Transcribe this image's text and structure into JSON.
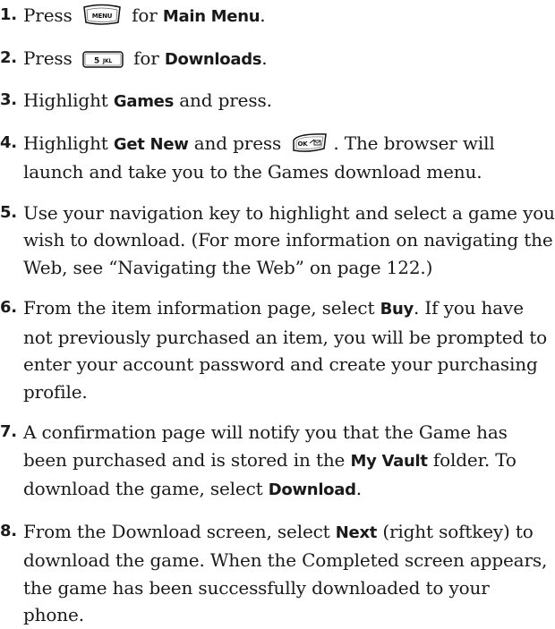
{
  "steps": [
    {
      "number": "1.",
      "parts": {
        "t1": "Press",
        "key": "MENU",
        "t2": "for",
        "b1": "Main Menu",
        "t3": "."
      }
    },
    {
      "number": "2.",
      "parts": {
        "t1": "Press",
        "key_num": "5",
        "key_letters": "JKL",
        "t2": "for",
        "b1": "Downloads",
        "t3": "."
      }
    },
    {
      "number": "3.",
      "parts": {
        "t1": "Highlight",
        "b1": "Games",
        "t2": "and press."
      }
    },
    {
      "number": "4.",
      "parts": {
        "t1": "Highlight",
        "b1": "Get New",
        "t2": "and press",
        "key": "OK",
        "t3": ". The browser will launch and take you to the Games download menu."
      }
    },
    {
      "number": "5.",
      "parts": {
        "t1": "Use your navigation key to highlight and select a game you wish to download. (For more information on navigating the Web, see “Navigating the Web” on page 122.)"
      }
    },
    {
      "number": "6.",
      "parts": {
        "t1": "From the item information page, select",
        "b1": "Buy",
        "t2": ". If you have not previously purchased an item, you will be prompted to enter your account password and create your purchasing profile."
      }
    },
    {
      "number": "7.",
      "parts": {
        "t1": "A confirmation page will notify you that the Game has been purchased and is stored in the",
        "b1": "My Vault",
        "t2": "folder. To download the game, select",
        "b2": "Download",
        "t3": "."
      }
    },
    {
      "number": "8.",
      "parts": {
        "t1": "From the Download screen, select",
        "b1": "Next",
        "t2": "(right softkey) to download the game. When the Completed screen appears, the game has been successfully downloaded to your phone."
      }
    }
  ]
}
